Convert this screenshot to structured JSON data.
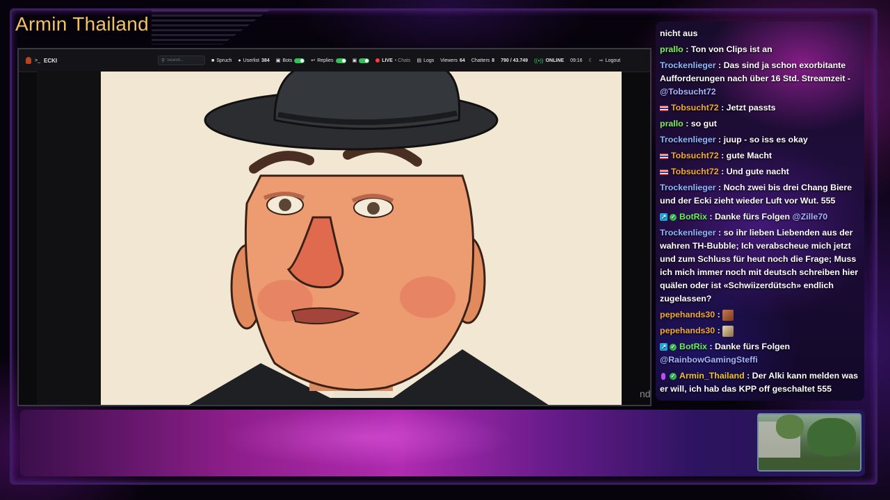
{
  "overlay": {
    "streamer_name": "Armin Thailand",
    "accent_color": "#f3c163"
  },
  "stream_window": {
    "toolbar": {
      "brand_name": "ECKI",
      "search_placeholder": "Search...",
      "spruch_label": "Spruch",
      "userlist_label": "Userlist",
      "userlist_count": "384",
      "bots_label": "Bots",
      "replies_label": "Replies",
      "live_label": "LIVE",
      "live_sub": "• Chats",
      "logs_label": "Logs",
      "viewers_label": "Viewers",
      "viewers_count": "64",
      "chatters_label": "Chatters",
      "chatters_count": "8",
      "ratio": "790 / 43.749",
      "online_label": "ONLINE",
      "time": "09:16",
      "logout_label": "Logout"
    },
    "video_caption": "nd"
  },
  "chat": {
    "messages": [
      {
        "badge": "",
        "user": "",
        "text": "nicht aus",
        "user_color": "#ffffff"
      },
      {
        "badge": "",
        "user": "prallo",
        "text": "Ton von Clips ist an",
        "user_color": "#7cf25a"
      },
      {
        "badge": "",
        "user": "Trockenlieger",
        "text": "Das sind ja schon exorbitante Aufforderungen nach über 16 Std. Streamzeit - ",
        "mention": "@Tobsucht72",
        "user_color": "#8fb8ff"
      },
      {
        "badge": "flag",
        "user": "Tobsucht72",
        "text": "Jetzt passts",
        "user_color": "#f0a93a"
      },
      {
        "badge": "",
        "user": "prallo",
        "text": "so gut",
        "user_color": "#7cf25a"
      },
      {
        "badge": "",
        "user": "Trockenlieger",
        "text": "juup - so iss es okay",
        "user_color": "#8fb8ff"
      },
      {
        "badge": "flag",
        "user": "Tobsucht72",
        "text": "gute Macht",
        "user_color": "#f0a93a"
      },
      {
        "badge": "flag",
        "user": "Tobsucht72",
        "text": "Und gute nacht",
        "user_color": "#f0a93a"
      },
      {
        "badge": "",
        "user": "Trockenlieger",
        "text": "Noch zwei bis drei Chang Biere und der Ecki zieht wieder Luft vor Wut. 555",
        "user_color": "#8fb8ff"
      },
      {
        "badge": "bot",
        "user": "BotRix",
        "text": "Danke fürs Folgen ",
        "mention": "@Zille70",
        "user_color": "#6cf25a"
      },
      {
        "badge": "",
        "user": "Trockenlieger",
        "text": "so ihr lieben Liebenden aus der wahren TH-Bubble; Ich verabscheue mich jetzt und zum Schluss für heut noch die Frage; Muss ich mich immer noch mit deutsch schreiben hier quälen oder ist «Schwiizerdütsch» endlich zugelassen?",
        "user_color": "#8fb8ff"
      },
      {
        "badge": "",
        "user": "pepehands30",
        "text": "",
        "emote": "a",
        "user_color": "#f0a93a"
      },
      {
        "badge": "",
        "user": "pepehands30",
        "text": "",
        "emote": "b",
        "user_color": "#f0a93a"
      },
      {
        "badge": "bot",
        "user": "BotRix",
        "text": "Danke fürs Folgen ",
        "mention": "@RainbowGamingSteffi",
        "user_color": "#6cf25a"
      },
      {
        "badge": "mic",
        "user": "Armin_Thailand",
        "text": "Der Alki kann melden was er will, ich hab das KPP off geschaltet 555",
        "user_color": "#f0c23a"
      }
    ]
  }
}
